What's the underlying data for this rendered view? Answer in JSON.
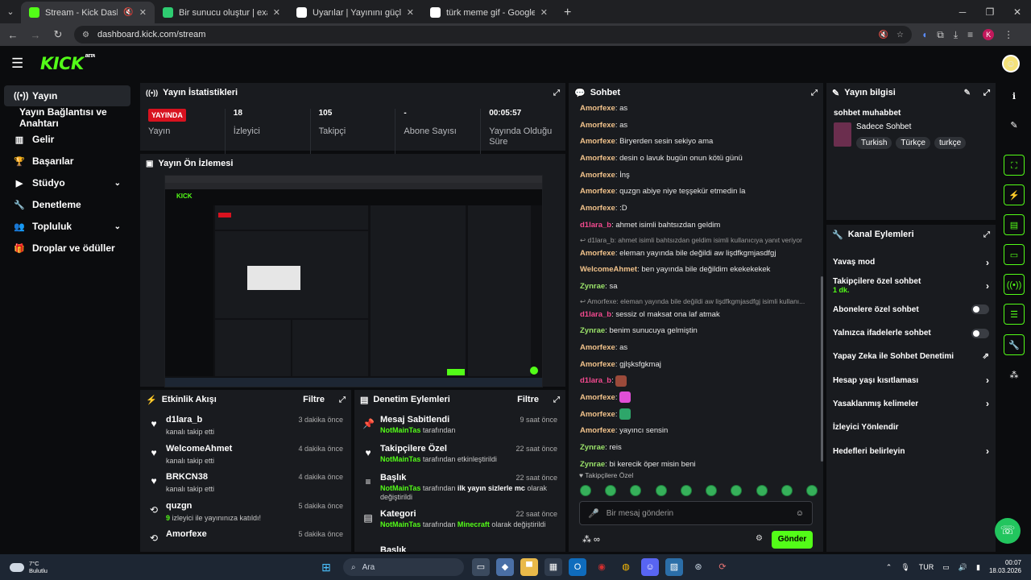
{
  "browser": {
    "tabs": [
      {
        "title": "Stream - Kick Dashboard",
        "active": true,
        "favicon_color": "#53fc18",
        "muted": true
      },
      {
        "title": "Bir sunucu oluştur | exaroton | C",
        "active": false,
        "favicon_color": "#2ecc71"
      },
      {
        "title": "Uyarılar | Yayınını güçlendirmek",
        "active": false,
        "favicon_color": "#ffffff"
      },
      {
        "title": "türk meme gif - Google'da Ara",
        "active": false,
        "favicon_color": "#ffffff"
      }
    ],
    "new_tab": "+",
    "url": "dashboard.kick.com/stream",
    "profile_initial": "K"
  },
  "kick": {
    "logo": "KICK",
    "logo_badge": "BETA"
  },
  "sidebar": {
    "items": [
      {
        "label": "Yayın",
        "icon": "broadcast-icon",
        "glyph": "((•))",
        "active": true
      },
      {
        "label": "Yayın Bağlantısı ve Anahtarı",
        "icon": "",
        "glyph": "",
        "sub": true
      },
      {
        "label": "Gelir",
        "icon": "chart-icon",
        "glyph": "▥"
      },
      {
        "label": "Başarılar",
        "icon": "trophy-icon",
        "glyph": "🏆"
      },
      {
        "label": "Stüdyo",
        "icon": "video-icon",
        "glyph": "▶",
        "chevron": true
      },
      {
        "label": "Denetleme",
        "icon": "wrench-icon",
        "glyph": "🔧"
      },
      {
        "label": "Topluluk",
        "icon": "people-icon",
        "glyph": "👥",
        "chevron": true
      },
      {
        "label": "Droplar ve ödüller",
        "icon": "gift-icon",
        "glyph": "🎁"
      }
    ]
  },
  "stats": {
    "title": "Yayın İstatistikleri",
    "live_badge": "YAYINDA",
    "cells": [
      {
        "value": "",
        "label": "Yayın"
      },
      {
        "value": "18",
        "label": "İzleyici"
      },
      {
        "value": "105",
        "label": "Takipçi"
      },
      {
        "value": "-",
        "label": "Abone Sayısı"
      },
      {
        "value": "00:05:57",
        "label": "Yayında Olduğu Süre"
      }
    ]
  },
  "preview": {
    "title": "Yayın Ön İzlemesi"
  },
  "activity": {
    "title": "Etkinlik Akışı",
    "filter": "Filtre",
    "items": [
      {
        "name": "d1lara_b",
        "sub": "kanalı takip etti",
        "time": "3 dakika önce",
        "icon": "heart-icon",
        "glyph": "♥"
      },
      {
        "name": "WelcomeAhmet",
        "sub": "kanalı takip etti",
        "time": "4 dakika önce",
        "icon": "heart-icon",
        "glyph": "♥"
      },
      {
        "name": "BRKCN38",
        "sub": "kanalı takip etti",
        "time": "4 dakika önce",
        "icon": "heart-icon",
        "glyph": "♥"
      },
      {
        "name": "quzgn",
        "sub_green": "9",
        "sub": " izleyici ile yayınınıza katıldı!",
        "time": "5 dakika önce",
        "icon": "raid-icon",
        "glyph": "⟲"
      },
      {
        "name": "Amorfexe",
        "sub": "",
        "time": "5 dakika önce",
        "icon": "raid-icon",
        "glyph": "⟲"
      }
    ]
  },
  "modlog": {
    "title": "Denetim Eylemleri",
    "filter": "Filtre",
    "items": [
      {
        "name": "Mesaj Sabitlendi",
        "actor": "NotMainTas",
        "rest": " tarafından",
        "time": "9 saat önce",
        "icon": "pin-icon",
        "glyph": "📌"
      },
      {
        "name": "Takipçilere Özel",
        "actor": "NotMainTas",
        "rest": " tarafından etkinleştirildi",
        "time": "22 saat önce",
        "icon": "heart-icon",
        "glyph": "♥"
      },
      {
        "name": "Başlık",
        "actor": "NotMainTas",
        "rest": " tarafından ",
        "bold": "ilk yayın sizlerle mc",
        "rest2": " olarak değiştirildi",
        "time": "22 saat önce",
        "icon": "title-icon",
        "glyph": "≡"
      },
      {
        "name": "Kategori",
        "actor": "NotMainTas",
        "rest": " tarafından ",
        "green2": "Minecraft",
        "rest2": " olarak değiştirildi",
        "time": "22 saat önce",
        "icon": "category-icon",
        "glyph": "▤"
      },
      {
        "name": "Başlık",
        "actor": "",
        "rest": "",
        "time": "",
        "icon": "title-icon",
        "glyph": "≡"
      }
    ]
  },
  "chat": {
    "title": "Sohbet",
    "messages": [
      {
        "user": "Amorfexe",
        "color": "#f2c38b",
        "text": "as"
      },
      {
        "user": "Amorfexe",
        "color": "#f2c38b",
        "text": "as"
      },
      {
        "user": "Amorfexe",
        "color": "#f2c38b",
        "text": "Biryerden sesin sekiyo ama"
      },
      {
        "user": "Amorfexe",
        "color": "#f2c38b",
        "text": "desin o lavuk bugün onun kötü günü"
      },
      {
        "user": "Amorfexe",
        "color": "#f2c38b",
        "text": "İnş"
      },
      {
        "user": "Amorfexe",
        "color": "#f2c38b",
        "text": "quzgn abiye niye teşşekür etmedin la"
      },
      {
        "user": "Amorfexe",
        "color": "#f2c38b",
        "text": ":D"
      },
      {
        "user": "d1lara_b",
        "color": "#f34a8f",
        "text": "ahmet isimli bahtsızdan geldim"
      },
      {
        "reply": "↩ d1lara_b: ahmet isimli bahtsızdan geldim isimli kullanıcıya yanıt veriyor"
      },
      {
        "user": "Amorfexe",
        "color": "#f2c38b",
        "text": "eleman yayında bile değildi aw lişdfkgmjasdfgj"
      },
      {
        "user": "WelcomeAhmet",
        "color": "#f2c38b",
        "text": "ben yayında bile değildim ekekekekek"
      },
      {
        "user": "Zynrae",
        "color": "#9be36a",
        "text": "sa"
      },
      {
        "reply": "↩ Amorfexe: eleman yayında bile değildi aw lişdfkgmjasdfgj isimli kullanı..."
      },
      {
        "user": "d1lara_b",
        "color": "#f34a8f",
        "text": "sessiz ol maksat ona laf atmak"
      },
      {
        "user": "Zynrae",
        "color": "#9be36a",
        "text": "benim sunucuya gelmiştin"
      },
      {
        "user": "Amorfexe",
        "color": "#f2c38b",
        "text": "as"
      },
      {
        "user": "Amorfexe",
        "color": "#f2c38b",
        "text": "gjlşksfgkmaj"
      },
      {
        "user": "d1lara_b",
        "color": "#f34a8f",
        "text": "",
        "emote": "#9b4a3a"
      },
      {
        "user": "Amorfexe",
        "color": "#f2c38b",
        "text": "",
        "emote": "#e04fd6"
      },
      {
        "user": "Amorfexe",
        "color": "#f2c38b",
        "text": "",
        "emote": "#2ea66a"
      },
      {
        "user": "Amorfexe",
        "color": "#f2c38b",
        "text": "yayıncı sensin"
      },
      {
        "user": "Zynrae",
        "color": "#9be36a",
        "text": "reis"
      },
      {
        "user": "Zynrae",
        "color": "#9be36a",
        "text": "bi kerecik öper misin beni"
      }
    ],
    "followers_only": "♥ Takipçilere Özel",
    "input_placeholder": "Bir mesaj gönderin",
    "send": "Gönder"
  },
  "streaminfo": {
    "title": "Yayın bilgisi",
    "stream_title": "sohbet muhabbet",
    "category": "Sadece Sohbet",
    "tags": [
      "Turkish",
      "Türkçe",
      "turkçe"
    ]
  },
  "channel_actions": {
    "title": "Kanal Eylemleri",
    "rows": [
      {
        "label": "Yavaş mod",
        "type": "chevron"
      },
      {
        "label": "Takipçilere özel sohbet",
        "sub": "1 dk.",
        "type": "chevron"
      },
      {
        "label": "Abonelere özel sohbet",
        "type": "toggle"
      },
      {
        "label": "Yalnızca ifadelerle sohbet",
        "type": "toggle"
      },
      {
        "label": "Yapay Zeka ile Sohbet Denetimi",
        "type": "external"
      },
      {
        "label": "Hesap yaşı kısıtlaması",
        "type": "chevron"
      },
      {
        "label": "Yasaklanmış kelimeler",
        "type": "chevron"
      },
      {
        "label": "İzleyici Yönlendir",
        "type": "none"
      },
      {
        "label": "Hedefleri belirleyin",
        "type": "chevron"
      }
    ]
  },
  "taskbar": {
    "temp": "7°C",
    "weather": "Bulutlu",
    "search": "Ara",
    "lang": "TUR",
    "time": "00:07",
    "date": "18.03.2026"
  },
  "colors": {
    "accent": "#53fc18",
    "live": "#d8121f",
    "panel": "#191b1f"
  }
}
